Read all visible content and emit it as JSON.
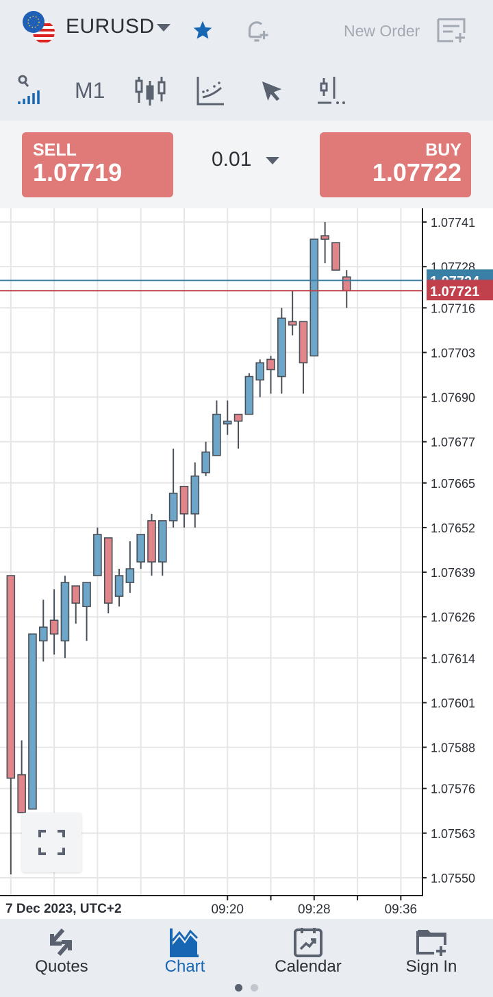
{
  "header": {
    "symbol": "EURUSD",
    "new_order_label": "New Order",
    "timeframe": "M1",
    "favorite": true
  },
  "trade": {
    "sell_label": "SELL",
    "sell_price": "1.07719",
    "buy_label": "BUY",
    "buy_price": "1.07722",
    "lot": "0.01"
  },
  "colors": {
    "bull": "#6ea6c9",
    "bear": "#e0868a",
    "ask_line": "#3a7fa6",
    "bid_line": "#c0404c",
    "accent": "#1766b3",
    "button": "#e07a79"
  },
  "chart_data": {
    "type": "candlestick",
    "date_label": "7 Dec 2023, UTC+2",
    "ylim": [
      1.07545,
      1.07745
    ],
    "y_ticks": [
      "1.07741",
      "1.07728",
      "1.07716",
      "1.07703",
      "1.07690",
      "1.07677",
      "1.07665",
      "1.07652",
      "1.07639",
      "1.07626",
      "1.07614",
      "1.07601",
      "1.07588",
      "1.07576",
      "1.07563",
      "1.07550"
    ],
    "x_ticks": [
      "09:20",
      "09:28",
      "09:36"
    ],
    "x_range": [
      "08:59",
      "09:38"
    ],
    "grid": true,
    "ask": "1.07724",
    "bid": "1.07721",
    "candles": [
      {
        "t": "09:00",
        "o": 1.07638,
        "h": 1.07638,
        "l": 1.07551,
        "c": 1.07579
      },
      {
        "t": "09:01",
        "o": 1.0758,
        "h": 1.0759,
        "l": 1.07569,
        "c": 1.07569
      },
      {
        "t": "09:02",
        "o": 1.0757,
        "h": 1.07621,
        "l": 1.0757,
        "c": 1.07621
      },
      {
        "t": "09:03",
        "o": 1.07619,
        "h": 1.07631,
        "l": 1.07613,
        "c": 1.07623
      },
      {
        "t": "09:04",
        "o": 1.07625,
        "h": 1.07634,
        "l": 1.07615,
        "c": 1.07621
      },
      {
        "t": "09:05",
        "o": 1.07619,
        "h": 1.07638,
        "l": 1.07614,
        "c": 1.07636
      },
      {
        "t": "09:06",
        "o": 1.07635,
        "h": 1.07635,
        "l": 1.07624,
        "c": 1.0763
      },
      {
        "t": "09:07",
        "o": 1.07629,
        "h": 1.07636,
        "l": 1.07619,
        "c": 1.07636
      },
      {
        "t": "09:08",
        "o": 1.07638,
        "h": 1.07652,
        "l": 1.07638,
        "c": 1.0765
      },
      {
        "t": "09:09",
        "o": 1.07649,
        "h": 1.07649,
        "l": 1.07627,
        "c": 1.0763
      },
      {
        "t": "09:10",
        "o": 1.07632,
        "h": 1.0764,
        "l": 1.07629,
        "c": 1.07638
      },
      {
        "t": "09:11",
        "o": 1.07636,
        "h": 1.07648,
        "l": 1.07633,
        "c": 1.0764
      },
      {
        "t": "09:12",
        "o": 1.07642,
        "h": 1.0765,
        "l": 1.0764,
        "c": 1.0765
      },
      {
        "t": "09:13",
        "o": 1.07654,
        "h": 1.07656,
        "l": 1.07638,
        "c": 1.07642
      },
      {
        "t": "09:14",
        "o": 1.07642,
        "h": 1.07654,
        "l": 1.07638,
        "c": 1.07654
      },
      {
        "t": "09:15",
        "o": 1.07654,
        "h": 1.07675,
        "l": 1.07652,
        "c": 1.07662
      },
      {
        "t": "09:16",
        "o": 1.07664,
        "h": 1.07664,
        "l": 1.07652,
        "c": 1.07656
      },
      {
        "t": "09:17",
        "o": 1.07656,
        "h": 1.07671,
        "l": 1.07652,
        "c": 1.07667
      },
      {
        "t": "09:18",
        "o": 1.07668,
        "h": 1.07677,
        "l": 1.07667,
        "c": 1.07674
      },
      {
        "t": "09:19",
        "o": 1.07673,
        "h": 1.07689,
        "l": 1.07673,
        "c": 1.07685
      },
      {
        "t": "09:20",
        "o": 1.07683,
        "h": 1.07689,
        "l": 1.07679,
        "c": 1.07683
      },
      {
        "t": "09:21",
        "o": 1.07685,
        "h": 1.07685,
        "l": 1.07675,
        "c": 1.07683
      },
      {
        "t": "09:22",
        "o": 1.07685,
        "h": 1.07697,
        "l": 1.07685,
        "c": 1.07696
      },
      {
        "t": "09:23",
        "o": 1.07695,
        "h": 1.07701,
        "l": 1.0769,
        "c": 1.077
      },
      {
        "t": "09:24",
        "o": 1.07701,
        "h": 1.07702,
        "l": 1.07691,
        "c": 1.07698
      },
      {
        "t": "09:25",
        "o": 1.07696,
        "h": 1.07716,
        "l": 1.07691,
        "c": 1.07713
      },
      {
        "t": "09:26",
        "o": 1.07712,
        "h": 1.07721,
        "l": 1.07708,
        "c": 1.07711
      },
      {
        "t": "09:27",
        "o": 1.07712,
        "h": 1.07712,
        "l": 1.07691,
        "c": 1.077
      },
      {
        "t": "09:28",
        "o": 1.07702,
        "h": 1.07736,
        "l": 1.07702,
        "c": 1.07736
      },
      {
        "t": "09:29",
        "o": 1.07737,
        "h": 1.07741,
        "l": 1.07729,
        "c": 1.07736
      },
      {
        "t": "09:30",
        "o": 1.07735,
        "h": 1.07735,
        "l": 1.07727,
        "c": 1.07727
      },
      {
        "t": "09:31",
        "o": 1.07725,
        "h": 1.07727,
        "l": 1.07716,
        "c": 1.07721
      }
    ]
  },
  "nav": {
    "items": [
      {
        "label": "Quotes",
        "active": false
      },
      {
        "label": "Chart",
        "active": true
      },
      {
        "label": "Calendar",
        "active": false
      },
      {
        "label": "Sign In",
        "active": false
      }
    ],
    "page_dots": 2,
    "active_dot": 1
  }
}
